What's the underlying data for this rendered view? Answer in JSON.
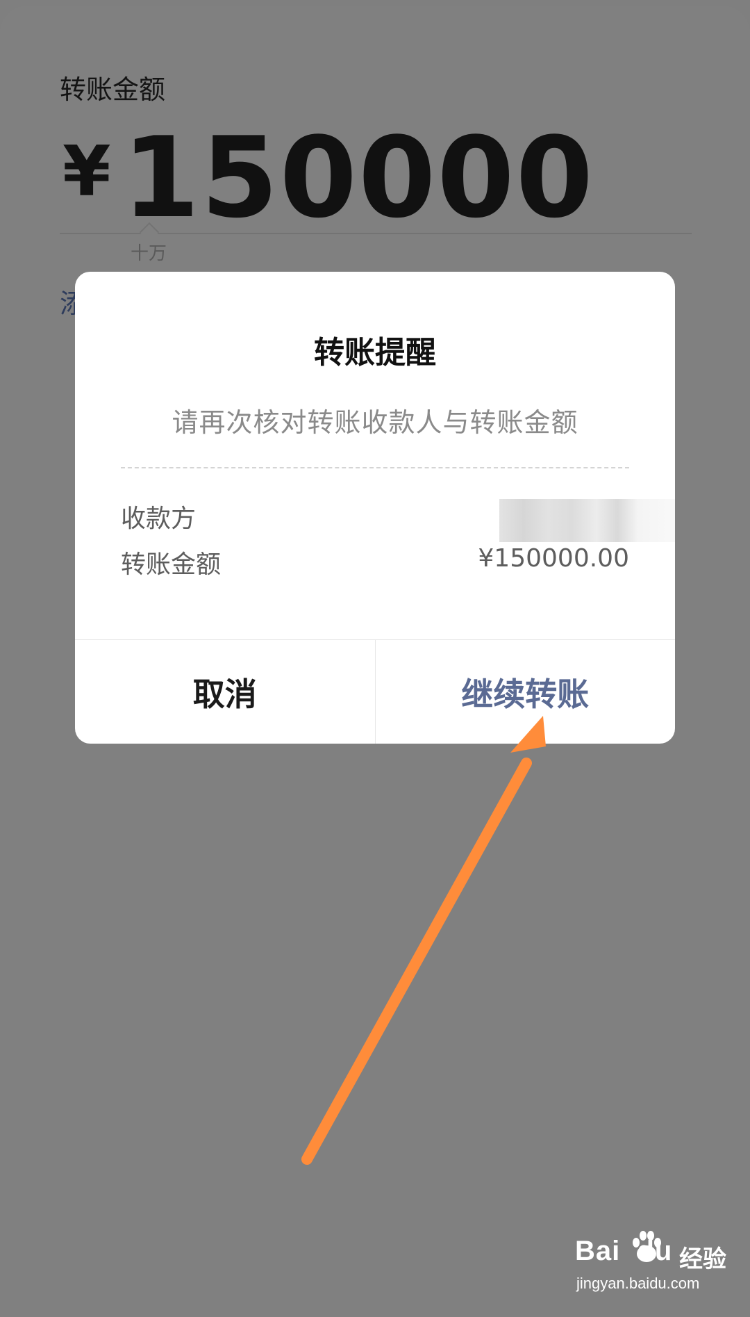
{
  "background": {
    "amount_label": "转账金额",
    "currency_sign": "¥",
    "amount_value": "150000",
    "unit_hint": "十万",
    "add_note_partial": "添"
  },
  "dialog": {
    "title": "转账提醒",
    "subtitle": "请再次核对转账收款人与转账金额",
    "rows": [
      {
        "label": "收款方",
        "value": ""
      },
      {
        "label": "转账金额",
        "value": "¥150000.00"
      }
    ],
    "buttons": {
      "cancel": "取消",
      "continue": "继续转账"
    }
  },
  "watermark": {
    "logo": "Bai",
    "logo_tail": "du",
    "brand_cn": "经验",
    "url": "jingyan.baidu.com"
  },
  "colors": {
    "overlay": "#808080",
    "continue_button": "#5a6a93",
    "annotation_arrow": "#ff8c3a"
  },
  "icons": [
    "baidu-paw-icon",
    "annotation-arrow-icon"
  ]
}
